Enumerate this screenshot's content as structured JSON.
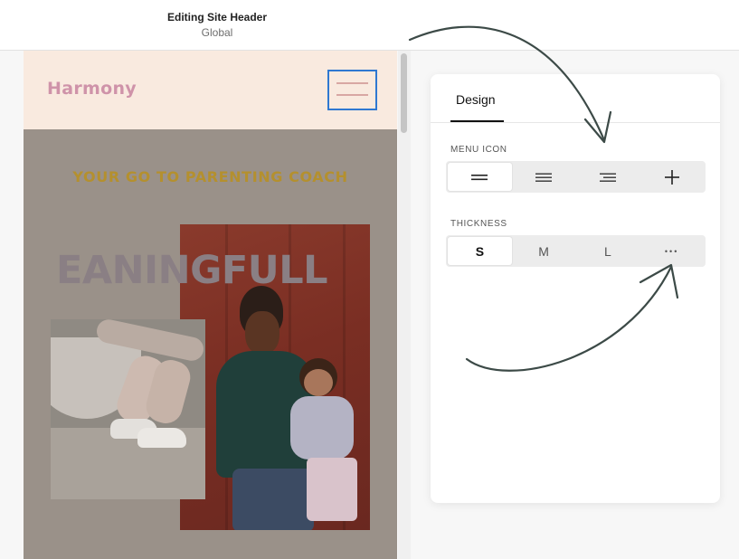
{
  "topbar": {
    "title": "Editing Site Header",
    "subtitle": "Global"
  },
  "preview": {
    "logo": "Harmony",
    "tagline": "YOUR GO TO PARENTING COACH",
    "hero_word": "EANINGFULL",
    "colors": {
      "header_bg": "#f9eadf",
      "logo": "#cf93a9",
      "tagline": "#b4902e",
      "selection_outline": "#2f78d1"
    }
  },
  "panel": {
    "tab": "Design",
    "menu_icon": {
      "label": "MENU ICON",
      "options": [
        {
          "icon": "two-lines-icon",
          "selected": true
        },
        {
          "icon": "three-lines-icon",
          "selected": false
        },
        {
          "icon": "right-aligned-lines-icon",
          "selected": false
        },
        {
          "icon": "plus-icon",
          "selected": false
        }
      ]
    },
    "thickness": {
      "label": "THICKNESS",
      "options": [
        {
          "label": "S",
          "selected": true
        },
        {
          "label": "M",
          "selected": false
        },
        {
          "label": "L",
          "selected": false
        },
        {
          "label": "•••",
          "selected": false
        }
      ]
    }
  }
}
